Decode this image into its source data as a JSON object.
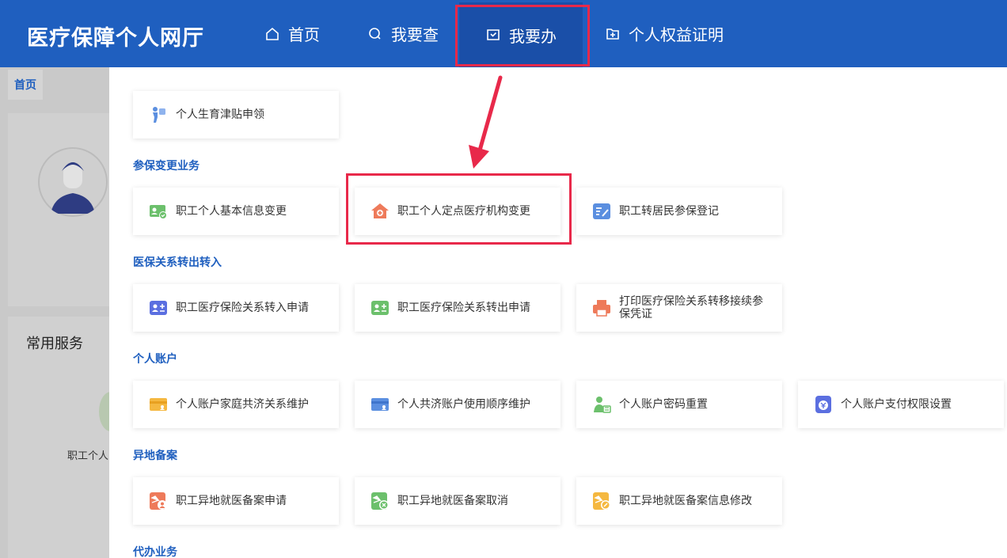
{
  "header": {
    "brand": "医疗保障个人网厅",
    "nav": [
      {
        "label": "首页",
        "icon": "home-icon"
      },
      {
        "label": "我要查",
        "icon": "search-icon"
      },
      {
        "label": "我要办",
        "icon": "inbox-check-icon"
      },
      {
        "label": "个人权益证明",
        "icon": "certificate-icon"
      }
    ]
  },
  "background": {
    "breadcrumb": "首页",
    "common_title": "常用服务",
    "common_item": "职工个人"
  },
  "panel": {
    "top_card": {
      "label": "个人生育津贴申领",
      "icon": "maternity-icon"
    },
    "sections": [
      {
        "title": "参保变更业务",
        "items": [
          {
            "label": "职工个人基本信息变更",
            "icon": "user-card-check-icon"
          },
          {
            "label": "职工个人定点医疗机构变更",
            "icon": "hospital-icon"
          },
          {
            "label": "职工转居民参保登记",
            "icon": "form-edit-icon"
          }
        ]
      },
      {
        "title": "医保关系转出转入",
        "items": [
          {
            "label": "职工医疗保险关系转入申请",
            "icon": "user-card-plus-icon"
          },
          {
            "label": "职工医疗保险关系转出申请",
            "icon": "user-card-plus-icon"
          },
          {
            "label": "打印医疗保险关系转移接续参保凭证",
            "icon": "printer-icon"
          }
        ]
      },
      {
        "title": "个人账户",
        "items": [
          {
            "label": "个人账户家庭共济关系维护",
            "icon": "wallet-family-icon"
          },
          {
            "label": "个人共济账户使用顺序维护",
            "icon": "card-user-icon"
          },
          {
            "label": "个人账户密码重置",
            "icon": "user-lock-icon"
          },
          {
            "label": "个人账户支付权限设置",
            "icon": "money-shield-icon"
          }
        ]
      },
      {
        "title": "异地备案",
        "items": [
          {
            "label": "职工异地就医备案申请",
            "icon": "plane-user-icon"
          },
          {
            "label": "职工异地就医备案取消",
            "icon": "plane-cancel-icon"
          },
          {
            "label": "职工异地就医备案信息修改",
            "icon": "plane-edit-icon"
          }
        ]
      },
      {
        "title": "代办业务",
        "items": []
      }
    ]
  },
  "colors": {
    "brand_blue": "#1f5fbf",
    "highlight_red": "#e8294a"
  }
}
